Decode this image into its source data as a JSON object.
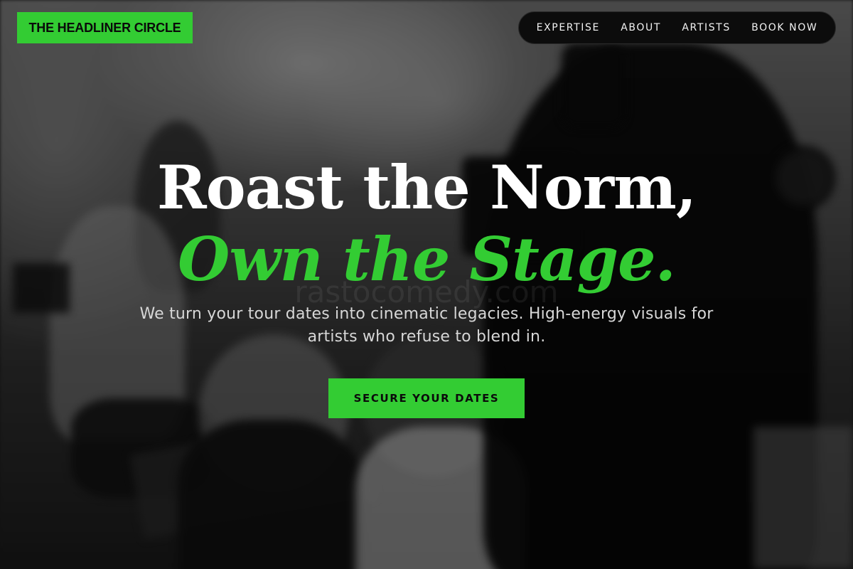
{
  "brand": {
    "logo_text": "THE HEADLINER CIRCLE"
  },
  "nav": {
    "items": [
      {
        "label": "EXPERTISE"
      },
      {
        "label": "ABOUT"
      },
      {
        "label": "ARTISTS"
      },
      {
        "label": "BOOK NOW"
      }
    ]
  },
  "hero": {
    "headline": "Roast the Norm,",
    "headline_accent": "Own the Stage.",
    "subtitle": "We turn your tour dates into cinematic legacies. High-energy visuals for artists who refuse to blend in.",
    "cta_label": "SECURE YOUR DATES",
    "watermark": "rastocomedy.com"
  },
  "colors": {
    "accent": "#33cc33",
    "nav_background": "#0c0c0c",
    "text": "#ffffff"
  }
}
